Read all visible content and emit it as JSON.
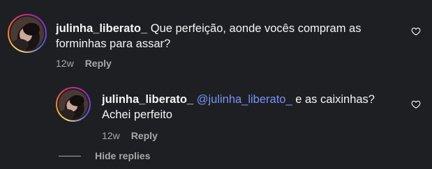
{
  "comments": [
    {
      "username": "julinha_liberato_",
      "text": "Que perfeição, aonde vocês compram as forminhas para assar?",
      "time": "12w",
      "reply_label": "Reply"
    }
  ],
  "replies": [
    {
      "username": "julinha_liberato_",
      "mention": "@julinha_liberato_",
      "text": "e as caixinhas? Achei perfeito",
      "time": "12w",
      "reply_label": "Reply"
    }
  ],
  "hide_replies_label": "Hide replies",
  "colors": {
    "background": "#1d1f23",
    "text": "#f5f5f5",
    "muted": "#a8a8a8",
    "mention": "#7b93f7"
  },
  "icons": {
    "like": "heart-outline-icon"
  }
}
